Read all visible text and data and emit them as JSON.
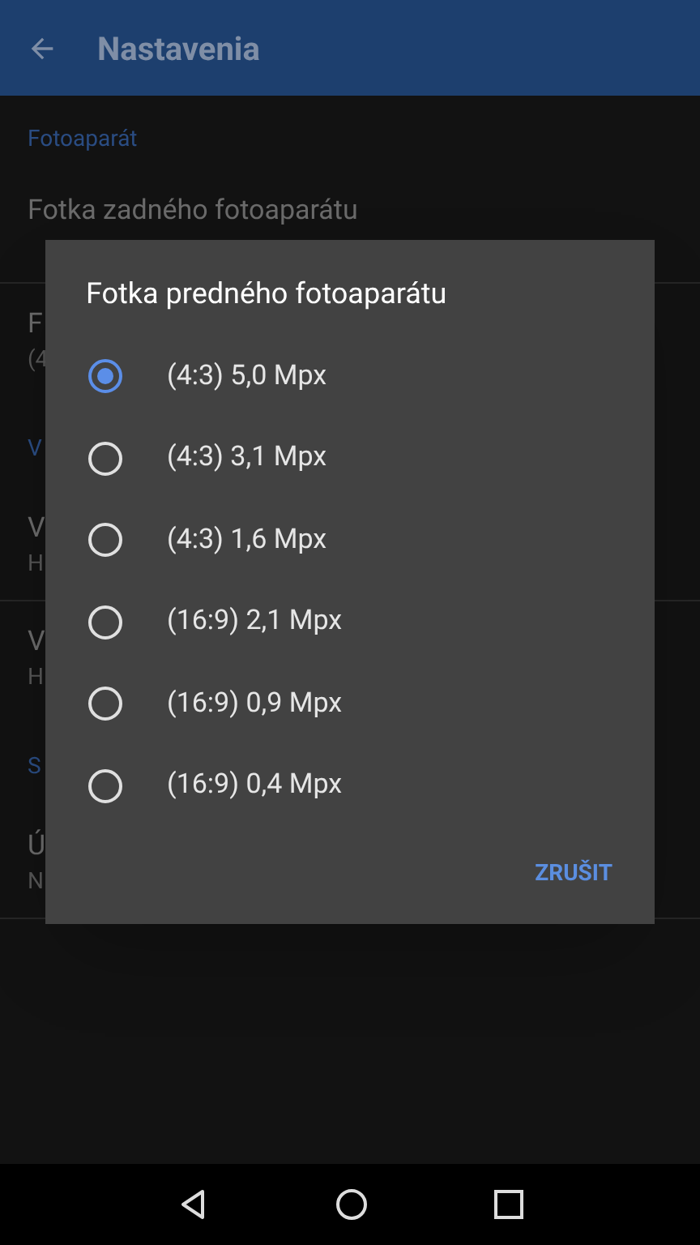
{
  "app_bar": {
    "title": "Nastavenia"
  },
  "settings": [
    {
      "kind": "header",
      "title": "Fotoaparát"
    },
    {
      "kind": "item",
      "title": "Fotka zadného fotoaparátu",
      "divider": true
    },
    {
      "kind": "item",
      "title": "F",
      "subtitle": "(4",
      "divider": false
    },
    {
      "kind": "header",
      "title": "V"
    },
    {
      "kind": "item",
      "title": "V",
      "subtitle": "H",
      "divider": true
    },
    {
      "kind": "item",
      "title": "V",
      "subtitle": "H",
      "divider": false
    },
    {
      "kind": "header",
      "title": "S"
    },
    {
      "kind": "item",
      "title": "Ú",
      "subtitle": "N",
      "divider": true
    }
  ],
  "dialog": {
    "title": "Fotka predného fotoaparátu",
    "options": [
      {
        "label": "(4:3) 5,0 Mpx",
        "selected": true
      },
      {
        "label": "(4:3) 3,1 Mpx",
        "selected": false
      },
      {
        "label": "(4:3) 1,6 Mpx",
        "selected": false
      },
      {
        "label": "(16:9) 2,1 Mpx",
        "selected": false
      },
      {
        "label": "(16:9) 0,9 Mpx",
        "selected": false
      },
      {
        "label": "(16:9) 0,4 Mpx",
        "selected": false
      }
    ],
    "buttons": [
      "ZRUŠIT"
    ]
  }
}
